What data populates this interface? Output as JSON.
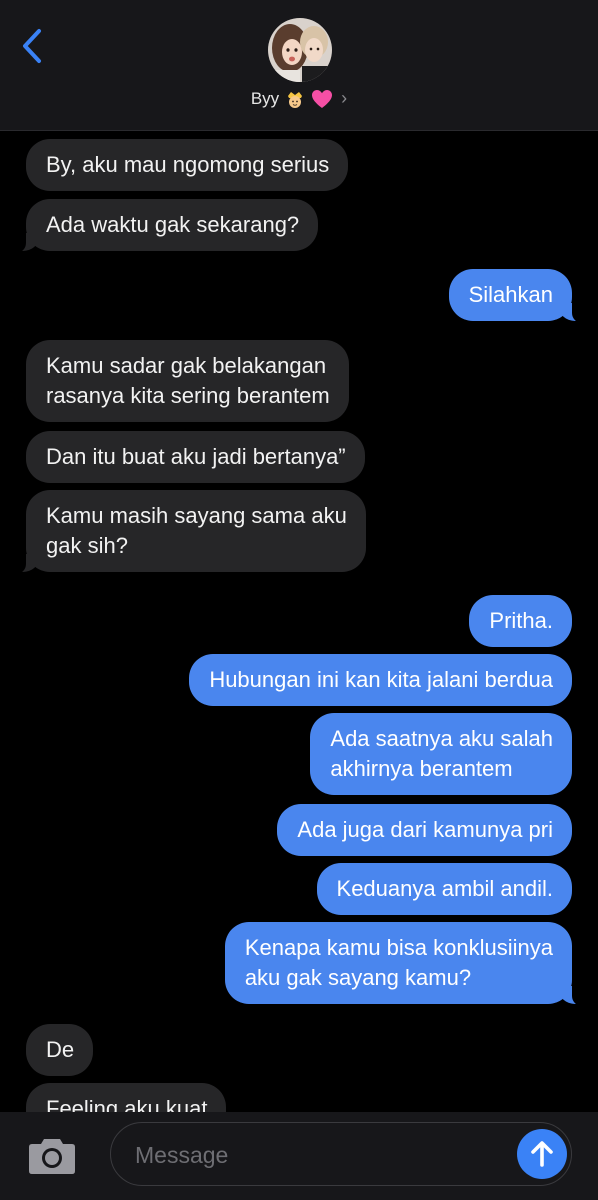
{
  "colors": {
    "header_bg": "#17171a",
    "incoming_bubble": "#262628",
    "outgoing_bubble": "#4a86ee",
    "accent": "#3a82f6"
  },
  "header": {
    "back_icon": "chevron-left-icon",
    "contact_name": "Byy",
    "contact_emojis": [
      "crown-person-emoji",
      "pink-heart-emoji"
    ],
    "disclosure_icon": "chevron-right-icon"
  },
  "messages": [
    {
      "direction": "in",
      "text": "By, aku mau ngomong serius"
    },
    {
      "direction": "in",
      "text": "Ada waktu gak sekarang?"
    },
    {
      "direction": "out",
      "text": "Silahkan"
    },
    {
      "direction": "in",
      "lines": [
        "Kamu sadar gak belakangan",
        "rasanya kita sering berantem"
      ]
    },
    {
      "direction": "in",
      "text": "Dan itu buat aku jadi bertanya”"
    },
    {
      "direction": "in",
      "lines": [
        "Kamu masih sayang sama aku",
        "gak sih?"
      ]
    },
    {
      "direction": "out",
      "text": "Pritha."
    },
    {
      "direction": "out",
      "text": "Hubungan ini kan kita jalani berdua"
    },
    {
      "direction": "out",
      "lines": [
        "Ada saatnya aku salah",
        "akhirnya berantem"
      ]
    },
    {
      "direction": "out",
      "text": "Ada juga dari kamunya pri"
    },
    {
      "direction": "out",
      "text": "Keduanya ambil andil."
    },
    {
      "direction": "out",
      "lines": [
        "Kenapa kamu bisa konklusiinya",
        "aku gak sayang kamu?"
      ]
    },
    {
      "direction": "in",
      "text": "De"
    },
    {
      "direction": "in",
      "text": "Feeling aku kuat"
    }
  ],
  "composer": {
    "camera_icon": "camera-icon",
    "placeholder": "Message",
    "value": "",
    "send_icon": "arrow-up-icon"
  }
}
